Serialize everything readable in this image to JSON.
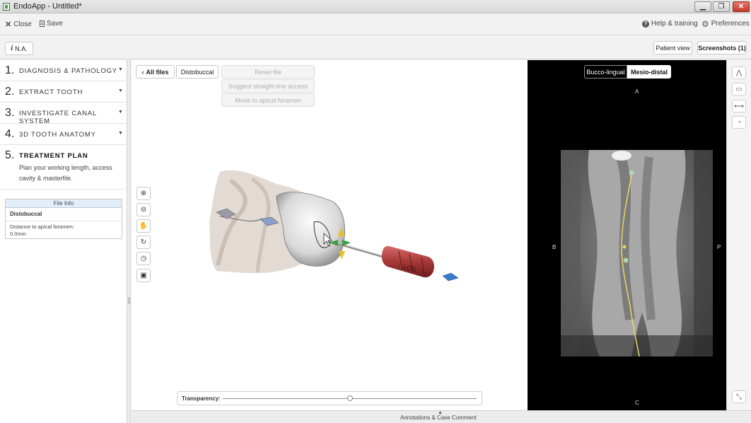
{
  "window": {
    "title": "EndoApp - Untitled*",
    "min": "▁",
    "max": "❐",
    "close": "✕"
  },
  "menubar": {
    "close": "Close",
    "save": "Save",
    "help": "Help & training",
    "preferences": "Preferences"
  },
  "toolbar": {
    "na": "N.A.",
    "patient_view": "Patient view",
    "screenshots": "Screenshots (1)"
  },
  "steps": [
    {
      "num": "1.",
      "label": "DIAGNOSIS & PATHOLOGY"
    },
    {
      "num": "2.",
      "label": "EXTRACT TOOTH"
    },
    {
      "num": "3.",
      "label": "INVESTIGATE CANAL SYSTEM"
    },
    {
      "num": "4.",
      "label": "3D TOOTH ANATOMY"
    },
    {
      "num": "5.",
      "label": "TREATMENT PLAN",
      "description": "Plan your working length, access cavity & masterfile."
    }
  ],
  "file_info": {
    "header": "File Info",
    "name": "Distobuccal",
    "distance_label": "Distance to apical foramen:",
    "distance_value": "0.0mm"
  },
  "view3d": {
    "all_files": "All files",
    "canal": "Distobuccal",
    "reset_file": "Reset file",
    "suggest_access": "Suggest straight-line access",
    "move_to_apical": "Move to apical foramen",
    "transparency_label": "Transparency:",
    "transparency_value": 0.5,
    "file_marking": "LOG"
  },
  "ct_view": {
    "tab_bucco": "Bucco-lingual",
    "tab_mesio": "Mesio-distal",
    "selected_tab": "Mesio-distal",
    "orient_top": "A",
    "orient_left": "B",
    "orient_right": "P",
    "orient_bottom": "C"
  },
  "bottom_bar": {
    "label": "Annotations & Case Comment"
  },
  "icons": {
    "zoom_in": "zoom-in-icon",
    "zoom_out": "zoom-out-icon",
    "pan": "hand-icon",
    "rotate": "rotate-icon",
    "history": "history-icon",
    "camera": "camera-icon",
    "angle": "angle-icon",
    "comment": "comment-icon",
    "measure": "measure-icon",
    "protractor": "protractor-icon",
    "expand": "expand-icon"
  },
  "colors": {
    "canal_path": "#e8d860",
    "file_handle": "#b84040",
    "ct_background": "#000000"
  }
}
